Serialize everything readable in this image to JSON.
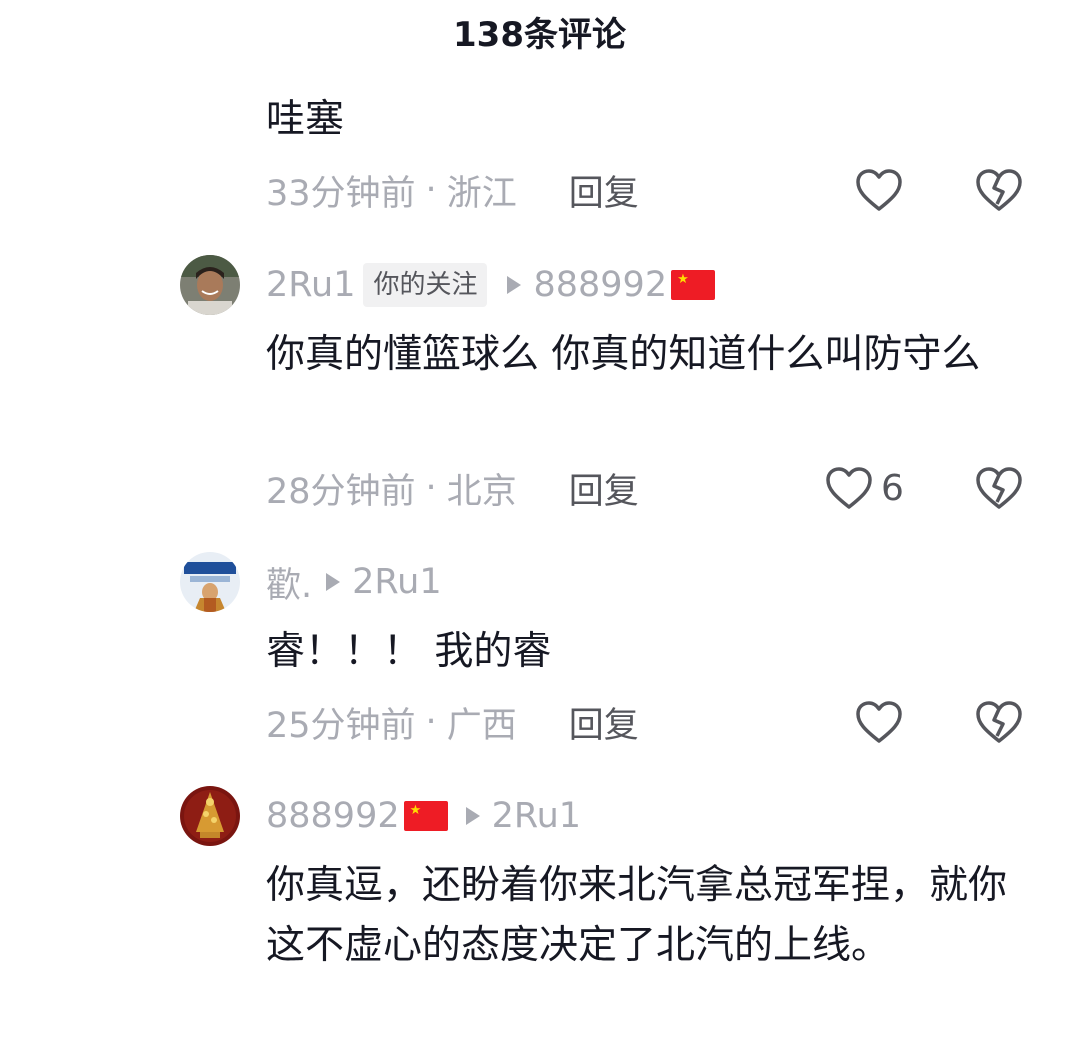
{
  "header": {
    "title": "138条评论"
  },
  "comments": [
    {
      "text": "哇塞",
      "time": "33分钟前",
      "location": "浙江",
      "reply_label": "回复",
      "likes": ""
    },
    {
      "user": "2Ru1",
      "tag": "你的关注",
      "reply_to": "888992",
      "text": "你真的懂篮球么 你真的知道什么叫防守么",
      "time": "28分钟前",
      "location": "北京",
      "reply_label": "回复",
      "likes": "6"
    },
    {
      "user": "歡.",
      "reply_to": "2Ru1",
      "text": "睿！！！ 我的睿",
      "time": "25分钟前",
      "location": "广西",
      "reply_label": "回复",
      "likes": ""
    },
    {
      "user": "888992",
      "reply_to": "2Ru1",
      "text": "你真逗，还盼着你来北汽拿总冠军捏，就你这不虚心的态度决定了北汽的上线。"
    }
  ],
  "separator": "·",
  "flag_star": "★",
  "icons": {
    "like": "heart-outline-icon",
    "dislike": "broken-heart-icon",
    "reply_arrow": "triangle-right-icon"
  }
}
